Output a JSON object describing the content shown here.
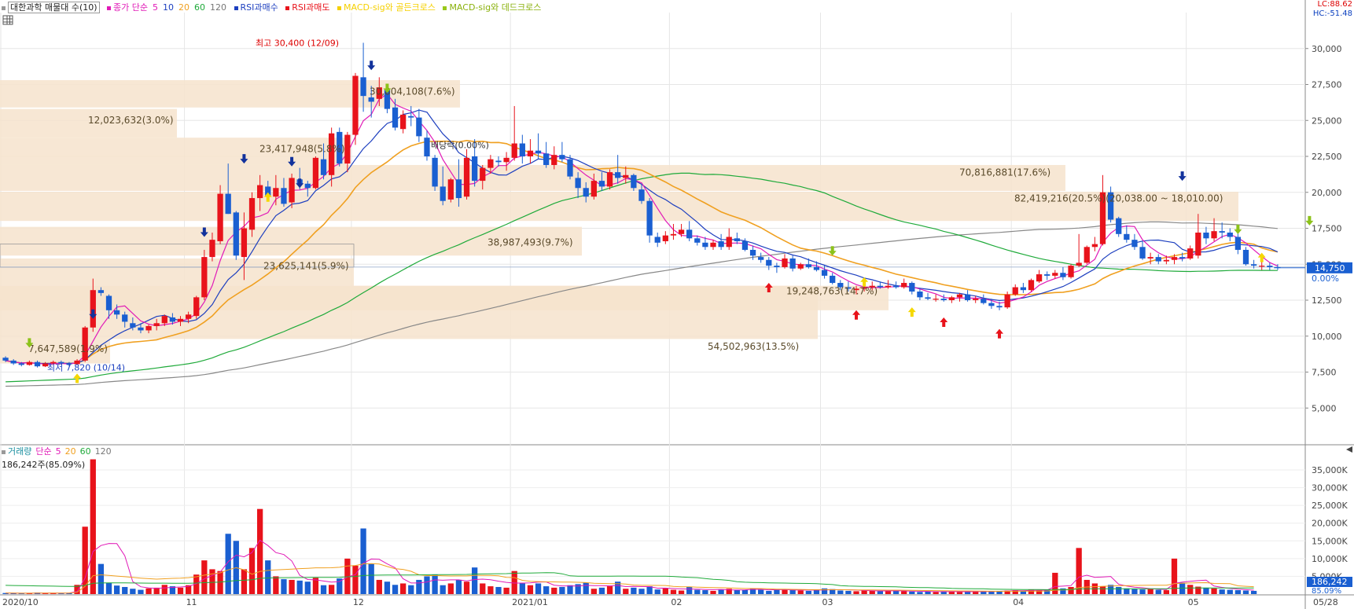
{
  "legend": {
    "stock": "대한과학 매물대 수(10)",
    "ma_label": "종가 단순",
    "ma_periods": [
      "5",
      "10",
      "20",
      "60",
      "120"
    ],
    "rsi_buy": "RSI과매수",
    "rsi_sell": "RSI과매도",
    "macd_golden": "MACD-sig와 골든크로스",
    "macd_dead": "MACD-sig와 데드크로스"
  },
  "indicators": {
    "lc": "LC:88.62",
    "hc": "HC:-51.48"
  },
  "volume_legend": {
    "label": "거래량",
    "ma_label": "단순",
    "ma_periods": [
      "5",
      "20",
      "60",
      "120"
    ],
    "current": "186,242주(85.09%)"
  },
  "colors": {
    "up": "#e8131b",
    "down": "#1a5fd1",
    "ma5": "#e11ab7",
    "ma10": "#1d3fbf",
    "ma20": "#f0a020",
    "ma60": "#1faa3a",
    "ma120": "#888888",
    "zone": "#f6e3cc"
  },
  "chart_data": {
    "type": "candlestick",
    "x_labels": [
      "2020/10",
      "11",
      "12",
      "2021/01",
      "02",
      "03",
      "04",
      "05",
      "05/28"
    ],
    "y_ticks": [
      "30,000",
      "27,500",
      "25,000",
      "22,500",
      "20,000",
      "17,500",
      "15,000",
      "12,500",
      "10,000",
      "7,500",
      "5,000"
    ],
    "ylim": [
      2500,
      32500
    ],
    "current_price": "14,750",
    "current_pct": "0.00%",
    "annotations": {
      "high": "최고 30,400 (12/09)",
      "low": "최저 7,820 (10/14)",
      "dividend": "배당락(0.00%)"
    },
    "volume_profile": [
      {
        "label": "7,647,589(1.9%)",
        "low": 9800,
        "high": 8100
      },
      {
        "label": "54,502,963(13.5%)",
        "low": 9800,
        "high": 13500
      },
      {
        "label": "19,248,763(14.7%)",
        "low": 11800,
        "high": 13500
      },
      {
        "label": "23,625,141(5.9%)",
        "low": 13500,
        "high": 15400
      },
      {
        "label": "38,987,493(9.7%)",
        "low": 15600,
        "high": 17600
      },
      {
        "label": "82,419,216(20.5%)(20,038.00 ~ 18,010.00)",
        "low": 18010,
        "high": 20038
      },
      {
        "label": "70,816,881(17.6%)",
        "low": 20100,
        "high": 21900
      },
      {
        "label": "23,417,948(5.8%)",
        "low": 21900,
        "high": 23800
      },
      {
        "label": "12,023,632(3.0%)",
        "low": 23800,
        "high": 25800
      },
      {
        "label": "30,804,108(7.6%)",
        "low": 25900,
        "high": 27800
      }
    ],
    "candles": [
      [
        8500,
        8600,
        8200,
        8300
      ],
      [
        8300,
        8400,
        8000,
        8100
      ],
      [
        8100,
        8200,
        7900,
        8000
      ],
      [
        8000,
        8300,
        7950,
        8200
      ],
      [
        8200,
        8300,
        7820,
        7900
      ],
      [
        7900,
        8200,
        7850,
        8100
      ],
      [
        8100,
        8300,
        8000,
        8200
      ],
      [
        8200,
        8300,
        8000,
        8100
      ],
      [
        8100,
        8200,
        7900,
        8050
      ],
      [
        8050,
        8400,
        8000,
        8300
      ],
      [
        8300,
        10700,
        8200,
        10600
      ],
      [
        10600,
        14000,
        10300,
        13200
      ],
      [
        13200,
        13400,
        12800,
        13000
      ],
      [
        12800,
        12900,
        11200,
        11800
      ],
      [
        11800,
        12200,
        11200,
        11500
      ],
      [
        11500,
        11700,
        10600,
        11000
      ],
      [
        10900,
        11300,
        10400,
        10600
      ],
      [
        10600,
        10900,
        10200,
        10400
      ],
      [
        10400,
        10800,
        10200,
        10700
      ],
      [
        10700,
        11200,
        10400,
        10900
      ],
      [
        10900,
        11500,
        10700,
        11400
      ],
      [
        11300,
        11600,
        10800,
        11000
      ],
      [
        11000,
        11400,
        10700,
        11200
      ],
      [
        11200,
        11700,
        10900,
        11500
      ],
      [
        11400,
        12800,
        11200,
        12700
      ],
      [
        12700,
        16000,
        12500,
        15500
      ],
      [
        15500,
        17200,
        15200,
        16700
      ],
      [
        16600,
        20500,
        16400,
        19900
      ],
      [
        19900,
        22000,
        18500,
        18500
      ],
      [
        18600,
        18700,
        15300,
        15600
      ],
      [
        15500,
        18600,
        13900,
        17500
      ],
      [
        17400,
        20000,
        16900,
        19600
      ],
      [
        19600,
        21200,
        18700,
        20500
      ],
      [
        20400,
        20800,
        19500,
        19700
      ],
      [
        19700,
        21200,
        19100,
        20300
      ],
      [
        20300,
        21000,
        19000,
        19200
      ],
      [
        19300,
        21300,
        18900,
        21000
      ],
      [
        20900,
        21700,
        20200,
        20600
      ],
      [
        20600,
        20800,
        19700,
        20300
      ],
      [
        20300,
        22500,
        20200,
        22400
      ],
      [
        22300,
        23400,
        20900,
        21200
      ],
      [
        21200,
        24500,
        20400,
        24100
      ],
      [
        24200,
        24500,
        21800,
        22000
      ],
      [
        22000,
        24200,
        21400,
        24000
      ],
      [
        24000,
        28300,
        23300,
        28100
      ],
      [
        28000,
        30400,
        25600,
        26700
      ],
      [
        26600,
        27400,
        25200,
        26300
      ],
      [
        26500,
        28000,
        26000,
        27300
      ],
      [
        27200,
        27400,
        25500,
        25800
      ],
      [
        25900,
        26500,
        24300,
        24500
      ],
      [
        24400,
        25700,
        24100,
        25400
      ],
      [
        25300,
        26000,
        24600,
        25200
      ],
      [
        25200,
        25800,
        23500,
        23900
      ],
      [
        23800,
        24300,
        22200,
        22500
      ],
      [
        22400,
        22600,
        20100,
        20400
      ],
      [
        20400,
        21800,
        19100,
        19400
      ],
      [
        19500,
        21000,
        19300,
        20900
      ],
      [
        20900,
        22300,
        19000,
        19600
      ],
      [
        19700,
        23000,
        19500,
        22400
      ],
      [
        22500,
        23700,
        20400,
        20800
      ],
      [
        20800,
        21900,
        20200,
        21700
      ],
      [
        21700,
        22600,
        21300,
        22300
      ],
      [
        22200,
        22500,
        21800,
        22100
      ],
      [
        22100,
        22800,
        21500,
        22400
      ],
      [
        22400,
        26000,
        22200,
        23400
      ],
      [
        23400,
        24000,
        22000,
        22500
      ],
      [
        22500,
        23700,
        22000,
        22900
      ],
      [
        22900,
        24100,
        22300,
        22700
      ],
      [
        22700,
        23500,
        21700,
        21900
      ],
      [
        21900,
        23200,
        21600,
        22600
      ],
      [
        22600,
        23500,
        22100,
        22300
      ],
      [
        22300,
        22600,
        20900,
        21100
      ],
      [
        21000,
        21400,
        19600,
        20300
      ],
      [
        20300,
        20700,
        19300,
        19700
      ],
      [
        19700,
        21300,
        19500,
        20800
      ],
      [
        20800,
        21400,
        20100,
        20400
      ],
      [
        20400,
        21600,
        20200,
        21400
      ],
      [
        21400,
        22600,
        20600,
        21000
      ],
      [
        21000,
        21800,
        20600,
        21200
      ],
      [
        21200,
        21300,
        20100,
        20300
      ],
      [
        20200,
        20600,
        19200,
        19400
      ],
      [
        19400,
        19600,
        16500,
        17000
      ],
      [
        16900,
        17200,
        16200,
        16500
      ],
      [
        16600,
        17300,
        16400,
        17000
      ],
      [
        17000,
        17800,
        16700,
        17100
      ],
      [
        17100,
        17800,
        16900,
        17400
      ],
      [
        17400,
        18000,
        16600,
        16800
      ],
      [
        16800,
        17000,
        16300,
        16500
      ],
      [
        16500,
        16900,
        16000,
        16200
      ],
      [
        16200,
        16700,
        16000,
        16500
      ],
      [
        16600,
        17100,
        16000,
        16200
      ],
      [
        16200,
        17500,
        16000,
        16900
      ],
      [
        16800,
        17200,
        16400,
        16600
      ],
      [
        16600,
        16800,
        15900,
        16000
      ],
      [
        16000,
        16300,
        15300,
        15600
      ],
      [
        15500,
        15800,
        15100,
        15300
      ],
      [
        15300,
        15500,
        14600,
        14900
      ],
      [
        14900,
        15100,
        14400,
        14800
      ],
      [
        14800,
        15700,
        14700,
        15400
      ],
      [
        15400,
        15600,
        14500,
        14700
      ],
      [
        14700,
        15100,
        14600,
        15000
      ],
      [
        15000,
        15400,
        14700,
        14800
      ],
      [
        14800,
        15200,
        14500,
        14600
      ],
      [
        14600,
        14900,
        14000,
        14200
      ],
      [
        14200,
        14400,
        13600,
        13700
      ],
      [
        13700,
        13900,
        13200,
        13400
      ],
      [
        13400,
        13800,
        13100,
        13300
      ],
      [
        13200,
        13500,
        12900,
        13300
      ],
      [
        13300,
        13800,
        13100,
        13400
      ],
      [
        13400,
        13800,
        13200,
        13500
      ],
      [
        13500,
        13800,
        13300,
        13400
      ],
      [
        13400,
        13900,
        13300,
        13500
      ],
      [
        13500,
        13800,
        13300,
        13400
      ],
      [
        13400,
        14000,
        13300,
        13700
      ],
      [
        13700,
        13800,
        12900,
        13100
      ],
      [
        13100,
        13300,
        12500,
        12700
      ],
      [
        12700,
        13000,
        12500,
        12600
      ],
      [
        12600,
        12900,
        12400,
        12600
      ],
      [
        12600,
        12900,
        12400,
        12500
      ],
      [
        12500,
        12800,
        12300,
        12700
      ],
      [
        12700,
        13000,
        12400,
        12900
      ],
      [
        12900,
        13200,
        12400,
        12500
      ],
      [
        12500,
        12800,
        12300,
        12600
      ],
      [
        12600,
        12900,
        12200,
        12300
      ],
      [
        12300,
        12600,
        11900,
        12100
      ],
      [
        12100,
        12400,
        11800,
        12000
      ],
      [
        12000,
        13100,
        11900,
        12900
      ],
      [
        12900,
        13600,
        12800,
        13400
      ],
      [
        13400,
        13700,
        13000,
        13200
      ],
      [
        13200,
        14000,
        13100,
        13900
      ],
      [
        13800,
        14600,
        13700,
        14300
      ],
      [
        14300,
        14500,
        13900,
        14200
      ],
      [
        14200,
        14600,
        14000,
        14400
      ],
      [
        14400,
        14800,
        13900,
        14100
      ],
      [
        14100,
        15000,
        14000,
        14900
      ],
      [
        14900,
        17100,
        14800,
        15100
      ],
      [
        15100,
        16300,
        15000,
        16200
      ],
      [
        16200,
        16900,
        15900,
        16400
      ],
      [
        16400,
        21200,
        16300,
        20000
      ],
      [
        20000,
        20400,
        17900,
        18100
      ],
      [
        18200,
        18300,
        16900,
        17100
      ],
      [
        17100,
        17700,
        16500,
        16700
      ],
      [
        16700,
        17100,
        16000,
        16200
      ],
      [
        16200,
        16600,
        15300,
        15400
      ],
      [
        15400,
        15800,
        15000,
        15500
      ],
      [
        15500,
        15700,
        15000,
        15200
      ],
      [
        15200,
        15600,
        15000,
        15300
      ],
      [
        15300,
        15700,
        15000,
        15500
      ],
      [
        15500,
        15800,
        15200,
        15400
      ],
      [
        15400,
        16300,
        15300,
        16100
      ],
      [
        15600,
        18500,
        15400,
        17200
      ],
      [
        17200,
        17600,
        16400,
        16800
      ],
      [
        16800,
        18200,
        16600,
        17300
      ],
      [
        17300,
        17900,
        16800,
        17200
      ],
      [
        17200,
        17500,
        16600,
        16900
      ],
      [
        16900,
        17200,
        15700,
        16000
      ],
      [
        16000,
        16200,
        14900,
        15000
      ],
      [
        15000,
        15300,
        14700,
        14900
      ],
      [
        14900,
        15200,
        14600,
        14900
      ],
      [
        14900,
        15100,
        14600,
        14800
      ],
      [
        14800,
        15000,
        14600,
        14750
      ]
    ],
    "volumes": [
      300,
      250,
      200,
      220,
      450,
      300,
      250,
      200,
      350,
      2600,
      19000,
      38000,
      8500,
      3200,
      2400,
      2000,
      1500,
      1200,
      1600,
      1800,
      2600,
      2200,
      1800,
      2500,
      5500,
      9500,
      7000,
      6500,
      17000,
      15000,
      7000,
      13000,
      24000,
      9500,
      5000,
      4200,
      4000,
      3800,
      3500,
      4600,
      2500,
      2600,
      4400,
      10000,
      8000,
      18500,
      8500,
      4000,
      3500,
      2600,
      3000,
      2500,
      4000,
      5000,
      5500,
      2500,
      3000,
      4000,
      3500,
      7500,
      3000,
      2200,
      2000,
      1800,
      6500,
      3000,
      2500,
      3000,
      2200,
      1800,
      2000,
      2500,
      2800,
      3200,
      1500,
      1800,
      2200,
      3500,
      1500,
      1800,
      1500,
      2200,
      1300,
      1600,
      1200,
      1000,
      2000,
      1200,
      1100,
      900,
      1300,
      1500,
      1100,
      1200,
      1600,
      1200,
      900,
      1300,
      1400,
      1100,
      1000,
      900,
      1200,
      1600,
      1400,
      1000,
      900,
      800,
      1000,
      900,
      800,
      900,
      1000,
      800,
      700,
      600,
      700,
      600,
      800,
      700,
      600,
      600,
      700,
      900,
      800,
      900,
      1000,
      1100,
      1000,
      1200,
      1100,
      1300,
      6000,
      1600,
      2000,
      13000,
      4000,
      3000,
      2200,
      2600,
      2000,
      1600,
      1400,
      1300,
      1400,
      1200,
      1100,
      10000,
      3200,
      2600,
      2100,
      1800,
      1600,
      1300,
      1200,
      1100,
      1000,
      900
    ],
    "volume_ticks": [
      "35,000K",
      "30,000K",
      "25,000K",
      "20,000K",
      "15,000K",
      "10,000K",
      "5,000K"
    ],
    "volume_ylim": [
      0,
      39000
    ],
    "volume_current": "186,242",
    "volume_pct": "85.09%"
  }
}
